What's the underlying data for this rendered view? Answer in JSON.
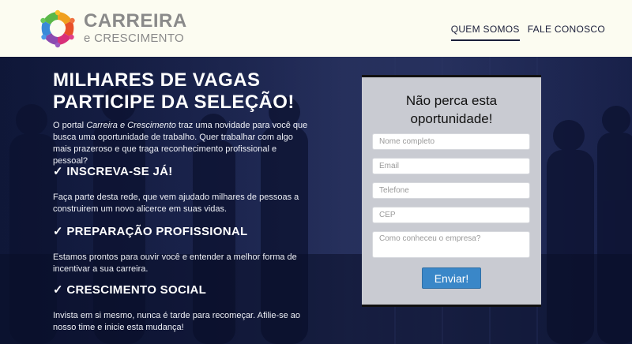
{
  "header": {
    "brand_main": "CARREIRA",
    "brand_sub": "e CRESCIMENTO",
    "nav": [
      {
        "label": "QUEM SOMOS",
        "active": true
      },
      {
        "label": "FALE CONOSCO",
        "active": false
      }
    ]
  },
  "hero": {
    "headline_line1": "MILHARES DE VAGAS",
    "headline_line2": "PARTICIPE DA SELEÇÃO!",
    "intro_prefix": "O portal ",
    "intro_brand": "Carreira e Crescimento",
    "intro_suffix": " traz uma novidade para você que busca uma oportunidade de trabalho. Quer trabalhar com algo mais prazeroso e que traga reconhecimento profissional e pessoal?",
    "sections": [
      {
        "title": "✓ INSCREVA-SE JÁ!",
        "text": "Faça parte desta rede, que vem ajudado milhares de pessoas a construirem um novo alicerce em suas vidas."
      },
      {
        "title": "✓ PREPARAÇÃO PROFISSIONAL",
        "text": "Estamos prontos para ouvir você e entender a melhor forma de incentivar a sua carreira."
      },
      {
        "title": "✓ CRESCIMENTO SOCIAL",
        "text": "Invista em si mesmo, nunca é tarde para recomeçar. Afilie-se ao nosso time e inicie esta mudança!"
      }
    ]
  },
  "form": {
    "title_line1": "Não perca esta",
    "title_line2": "oportunidade!",
    "fields": {
      "name_placeholder": "Nome completo",
      "email_placeholder": "Email",
      "phone_placeholder": "Telefone",
      "cep_placeholder": "CEP",
      "how_placeholder": "Como conheceu o empresa?"
    },
    "submit_label": "Enviar!"
  },
  "colors": {
    "header_bg": "#fcfcf1",
    "hero_bg": "#131b3f",
    "accent_button": "#3a87c8"
  }
}
